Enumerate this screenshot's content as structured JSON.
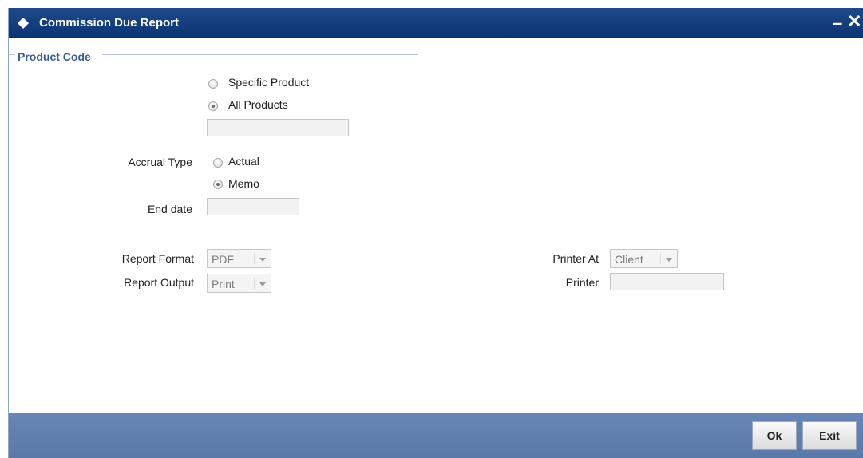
{
  "window": {
    "title": "Commission Due Report",
    "minimize_symbol": "–",
    "close_symbol": "✕"
  },
  "product_code": {
    "section_title": "Product Code",
    "options": [
      {
        "label": "Specific Product",
        "selected": false
      },
      {
        "label": "All Products",
        "selected": true
      }
    ],
    "product_value": ""
  },
  "accrual_type": {
    "label": "Accrual Type",
    "options": [
      {
        "label": "Actual",
        "selected": false
      },
      {
        "label": "Memo",
        "selected": true
      }
    ]
  },
  "end_date": {
    "label": "End date",
    "value": ""
  },
  "report_format": {
    "label": "Report Format",
    "value": "PDF"
  },
  "report_output": {
    "label": "Report Output",
    "value": "Print"
  },
  "printer_at": {
    "label": "Printer At",
    "value": "Client"
  },
  "printer": {
    "label": "Printer",
    "value": ""
  },
  "footer": {
    "ok_label": "Ok",
    "exit_label": "Exit"
  },
  "colors": {
    "titlebar": "#0a3372",
    "footer": "#6886b5",
    "section_title": "#3a5e8f"
  }
}
